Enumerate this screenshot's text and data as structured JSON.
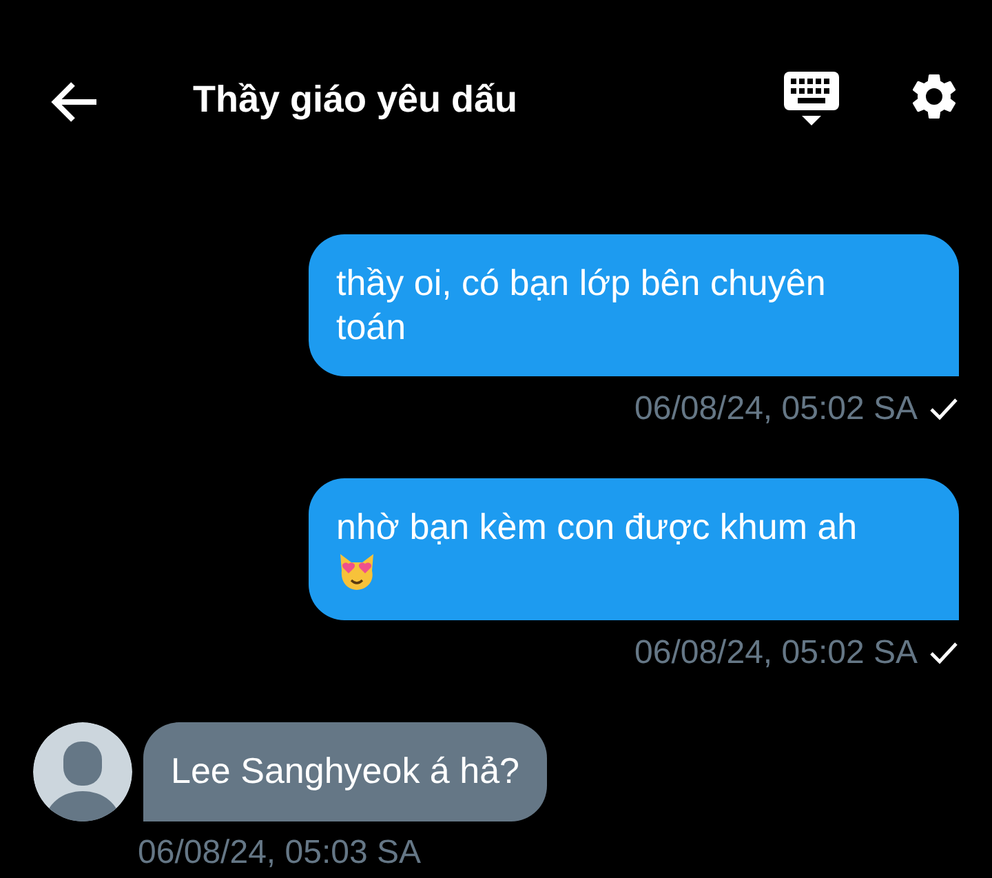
{
  "header": {
    "title": "Thầy giáo yêu dấu"
  },
  "messages": [
    {
      "kind": "outgoing",
      "text": "thầy oi, có bạn lớp bên chuyên toán",
      "has_emoji": false,
      "time": "06/08/24, 05:02 SA",
      "sent": true
    },
    {
      "kind": "outgoing",
      "text": "nhờ bạn kèm con được khum ah",
      "has_emoji": true,
      "time": "06/08/24, 05:02 SA",
      "sent": true
    },
    {
      "kind": "incoming",
      "text": "Lee Sanghyeok á hả?",
      "has_emoji": false,
      "time": "06/08/24, 05:03 SA",
      "sent": false
    }
  ]
}
